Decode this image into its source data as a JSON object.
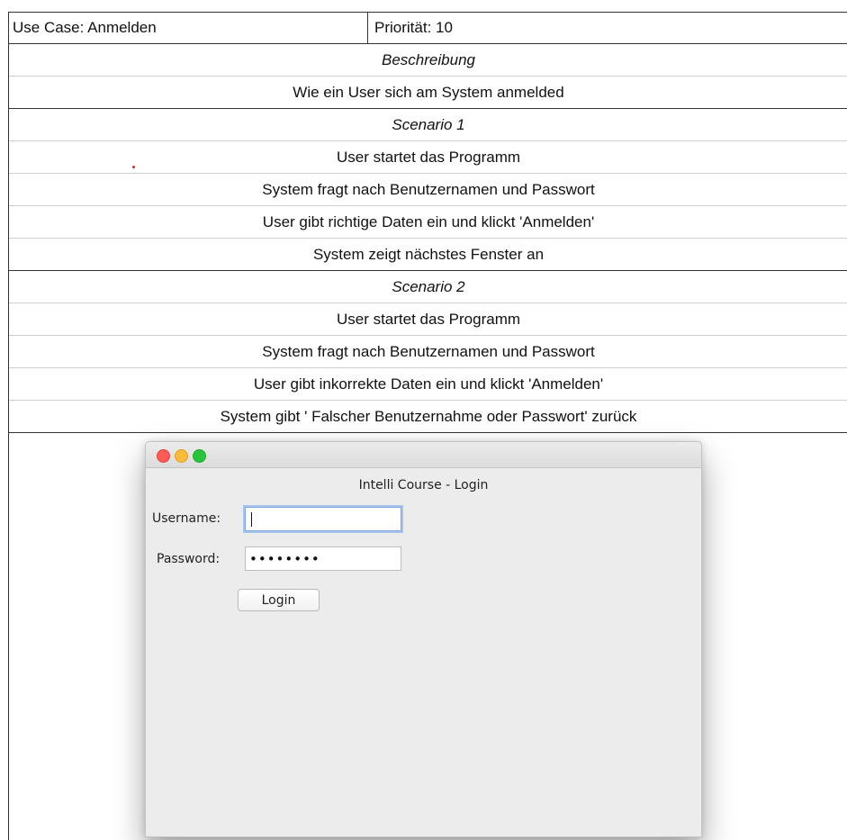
{
  "header": {
    "use_case": "Use Case: Anmelden",
    "priority": "Priorität: 10"
  },
  "description": {
    "heading": "Beschreibung",
    "text": "Wie ein User sich am System anmelded"
  },
  "scenario1": {
    "heading": "Scenario 1",
    "steps": [
      "User startet das Programm",
      "System fragt nach Benutzernamen und Passwort",
      "User gibt richtige Daten ein und klickt 'Anmelden'",
      "System zeigt nächstes Fenster an"
    ]
  },
  "scenario2": {
    "heading": "Scenario 2",
    "steps": [
      "User startet das Programm",
      "System fragt nach Benutzernamen und Passwort",
      "User gibt inkorrekte Daten ein und klickt 'Anmelden'",
      "System gibt ' Falscher Benutzernahme oder Passwort' zurück"
    ]
  },
  "login_window": {
    "title": "Intelli Course - Login",
    "username_label": "Username:",
    "username_value": "",
    "password_label": "Password:",
    "password_value": "••••••••",
    "login_button": "Login"
  },
  "colors": {
    "close": "#fc5b57",
    "minimize": "#f8bb3c",
    "zoom": "#2ac33f",
    "focus_ring": "#a6c5ee"
  }
}
